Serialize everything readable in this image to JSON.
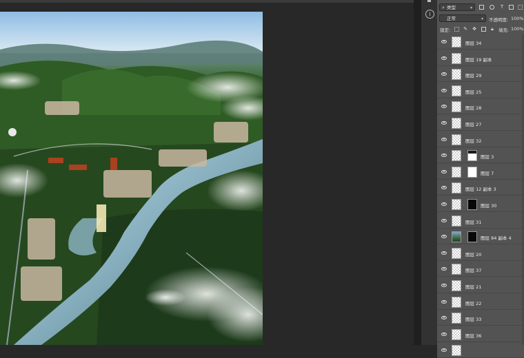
{
  "panel": {
    "filter_label": "类型",
    "blend_mode": "正常",
    "opacity_label": "不透明度:",
    "opacity_value": "100%",
    "lock_label": "锁定:",
    "fill_label": "填充:",
    "fill_value": "100%"
  },
  "layers": [
    {
      "name": "图层 34",
      "thumb": "checker",
      "mask": ""
    },
    {
      "name": "图层 19 副本",
      "thumb": "checker",
      "mask": ""
    },
    {
      "name": "图层 29",
      "thumb": "checker",
      "mask": ""
    },
    {
      "name": "图层 25",
      "thumb": "checker",
      "mask": ""
    },
    {
      "name": "图层 28",
      "thumb": "checker",
      "mask": ""
    },
    {
      "name": "图层 27",
      "thumb": "checker",
      "mask": ""
    },
    {
      "name": "图层 32",
      "thumb": "checker",
      "mask": ""
    },
    {
      "name": "图层 3",
      "thumb": "checker",
      "mask": "half"
    },
    {
      "name": "图层 7",
      "thumb": "checker",
      "mask": "white"
    },
    {
      "name": "图层 12 副本 3",
      "thumb": "checker",
      "mask": ""
    },
    {
      "name": "图层 30",
      "thumb": "checker",
      "mask": "dark"
    },
    {
      "name": "图层 31",
      "thumb": "checker",
      "mask": ""
    },
    {
      "name": "图层 84 副本 4",
      "thumb": "image",
      "mask": "dark"
    },
    {
      "name": "图层 20",
      "thumb": "checker",
      "mask": ""
    },
    {
      "name": "图层 37",
      "thumb": "checker",
      "mask": ""
    },
    {
      "name": "图层 21",
      "thumb": "checker",
      "mask": ""
    },
    {
      "name": "图层 22",
      "thumb": "checker",
      "mask": ""
    },
    {
      "name": "图层 33",
      "thumb": "checker",
      "mask": ""
    },
    {
      "name": "图层 36",
      "thumb": "checker",
      "mask": ""
    },
    {
      "name": "",
      "thumb": "checker",
      "mask": ""
    }
  ]
}
